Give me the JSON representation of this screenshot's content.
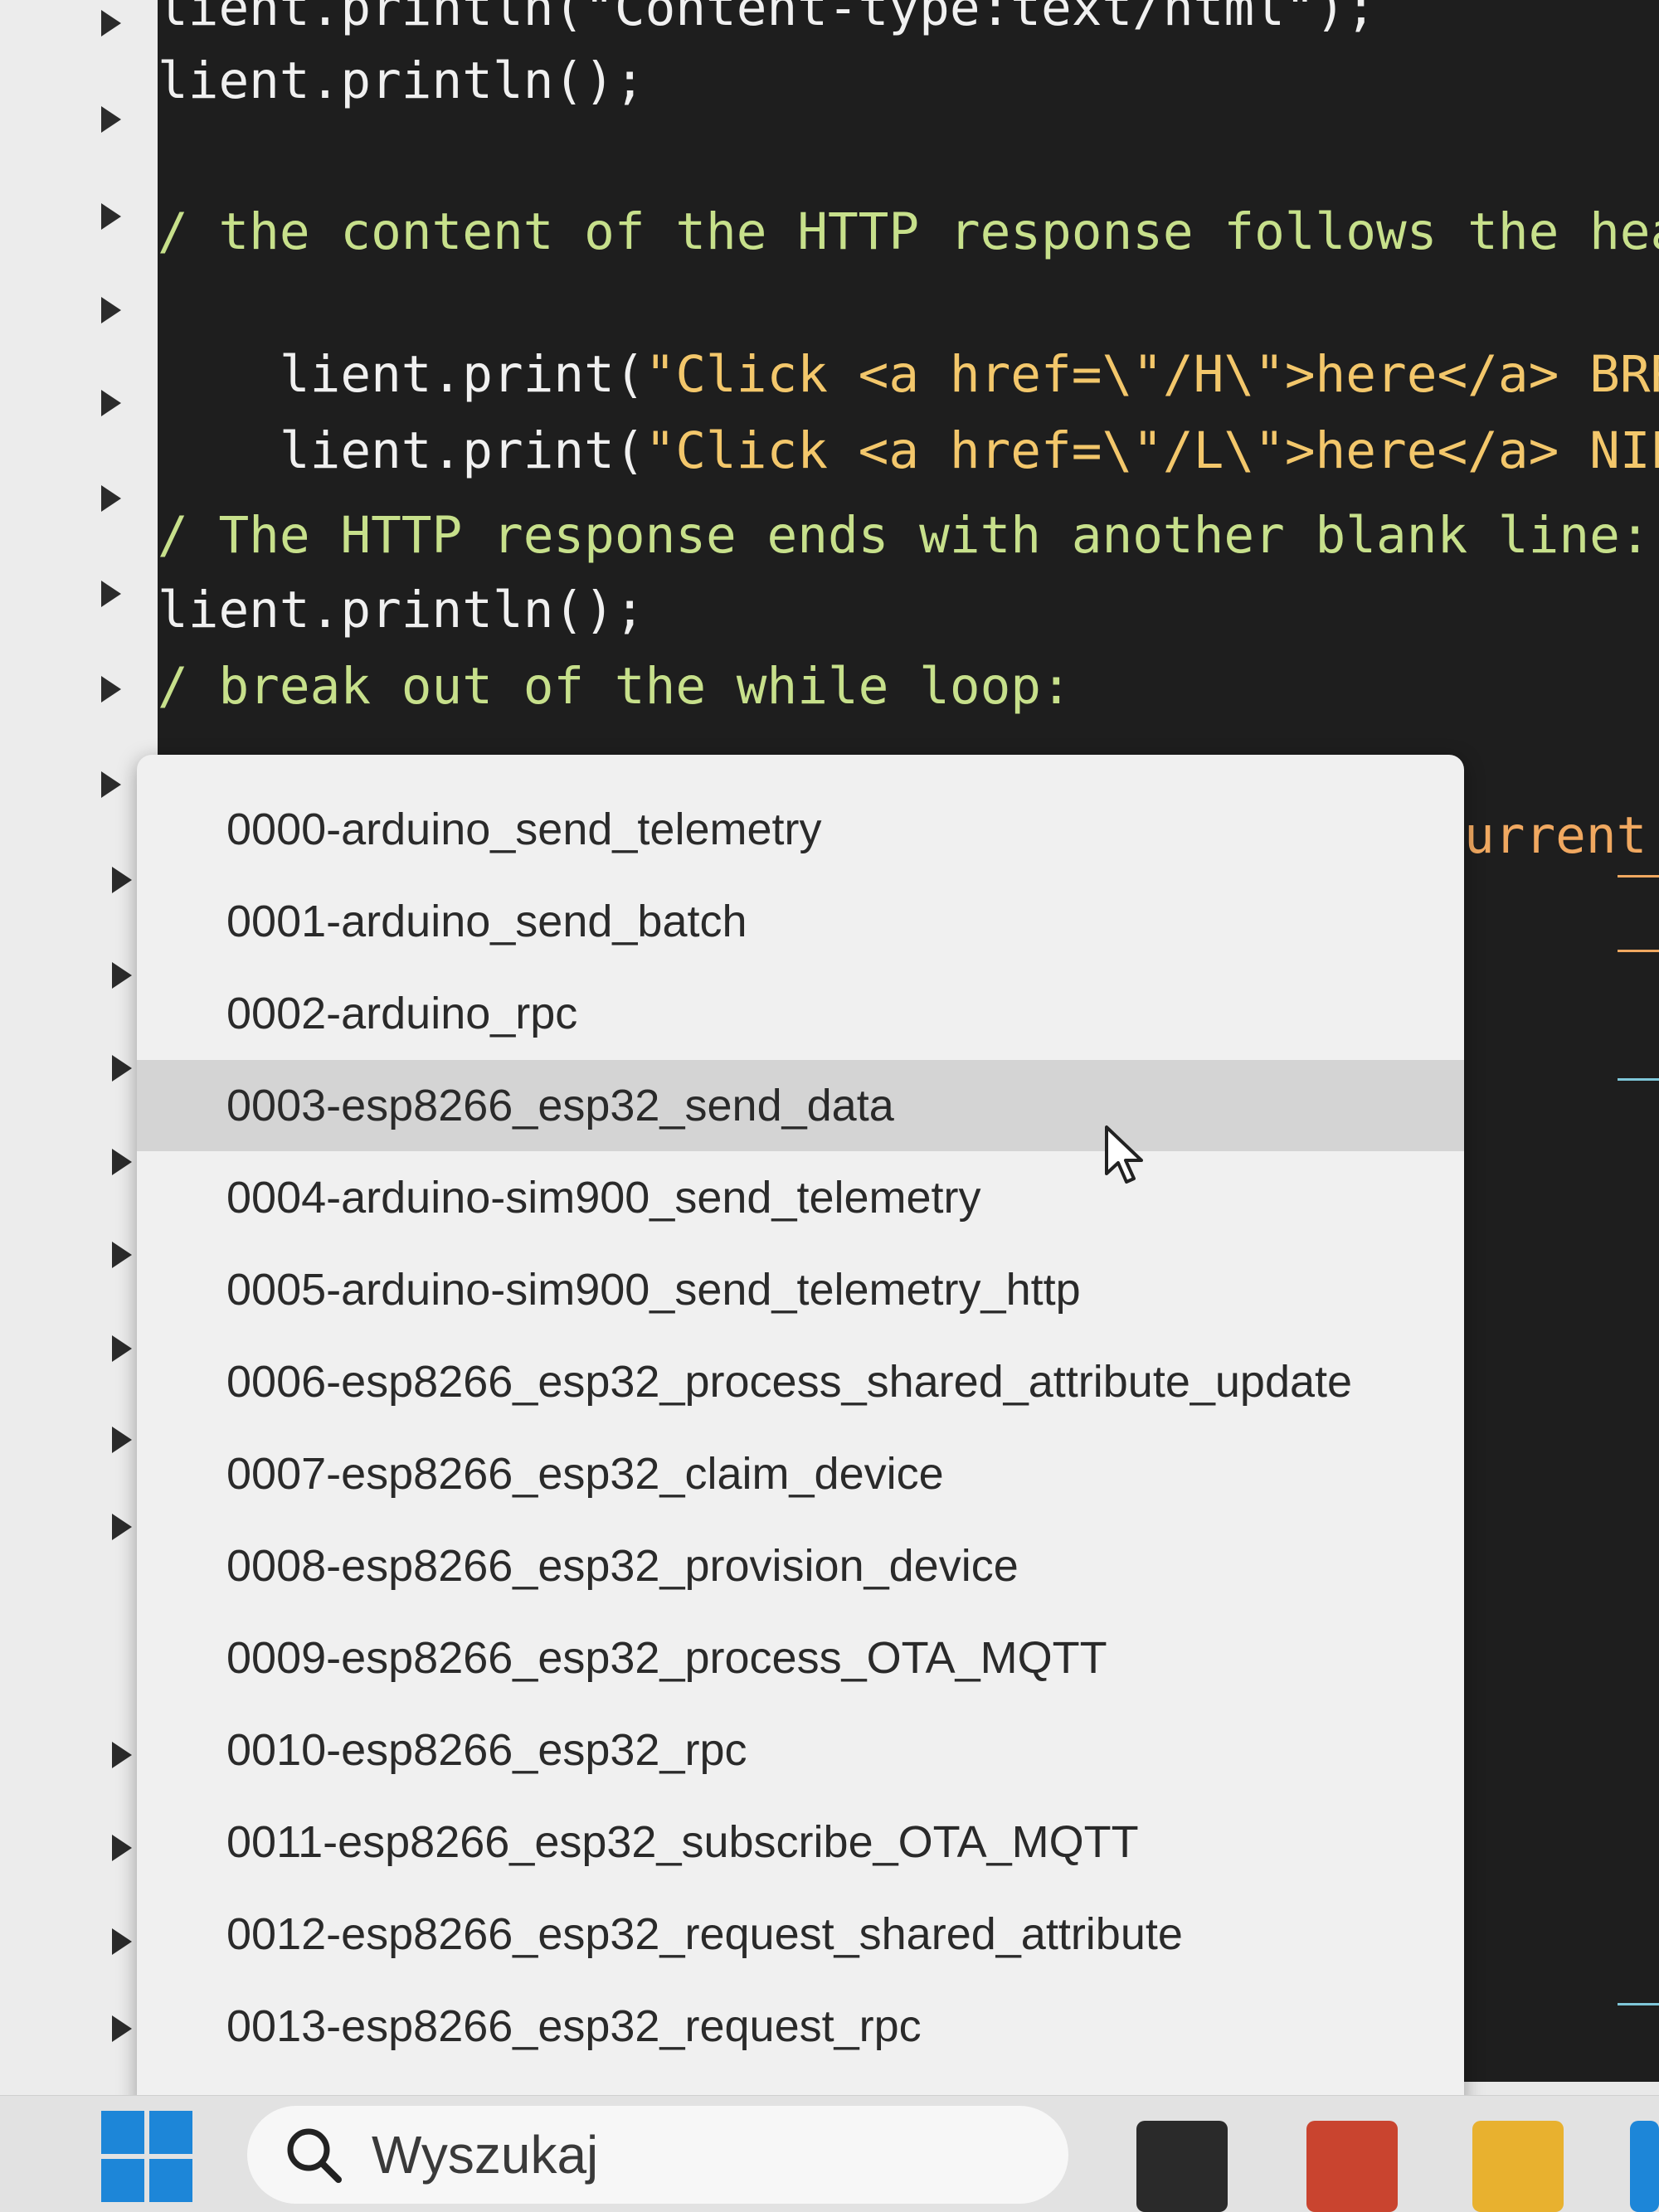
{
  "editor": {
    "lines": [
      {
        "id": "l0",
        "text": "lient.println(\"Content-type:text/html\");",
        "color": "white"
      },
      {
        "id": "l1",
        "text": "lient.println();",
        "color": "white"
      },
      {
        "id": "l2",
        "text": "/ the content of the HTTP response follows the hea",
        "color": "comment"
      },
      {
        "id": "l3a",
        "text": "lient.print(",
        "color": "white"
      },
      {
        "id": "l3b",
        "text": "\"Click <a href=\\\"/H\\\">here</a> BRRRRRR",
        "color": "yellow"
      },
      {
        "id": "l4a",
        "text": "lient.print(",
        "color": "white"
      },
      {
        "id": "l4b",
        "text": "\"Click <a href=\\\"/L\\\">here</a> NIE MA",
        "color": "yellow"
      },
      {
        "id": "l5",
        "text": "/ The HTTP response ends with another blank line:",
        "color": "comment"
      },
      {
        "id": "l6",
        "text": "lient.println();",
        "color": "white"
      },
      {
        "id": "l7",
        "text": "/ break out of the while loop:",
        "color": "comment"
      },
      {
        "id": "l8",
        "text": "urrent",
        "color": "orange"
      }
    ]
  },
  "dropdown": {
    "items": [
      "0000-arduino_send_telemetry",
      "0001-arduino_send_batch",
      "0002-arduino_rpc",
      "0003-esp8266_esp32_send_data",
      "0004-arduino-sim900_send_telemetry",
      "0005-arduino-sim900_send_telemetry_http",
      "0006-esp8266_esp32_process_shared_attribute_update",
      "0007-esp8266_esp32_claim_device",
      "0008-esp8266_esp32_provision_device",
      "0009-esp8266_esp32_process_OTA_MQTT",
      "0010-esp8266_esp32_rpc",
      "0011-esp8266_esp32_subscribe_OTA_MQTT",
      "0012-esp8266_esp32_request_shared_attribute",
      "0013-esp8266_esp32_request_rpc"
    ],
    "hovered_index": 3
  },
  "taskbar": {
    "search_placeholder": "Wyszukaj",
    "icons": [
      "windows-start-icon",
      "search-icon",
      "app-icon-dark",
      "app-icon-red",
      "folder-icon",
      "edge-icon"
    ]
  },
  "colors": {
    "editor_bg": "#1e1e1e",
    "code_white": "#f0f0f0",
    "code_string": "#f3c76b",
    "code_comment": "#c7e08b",
    "hover_bg": "#d4d4d4",
    "accent_blue": "#1d86d8"
  }
}
